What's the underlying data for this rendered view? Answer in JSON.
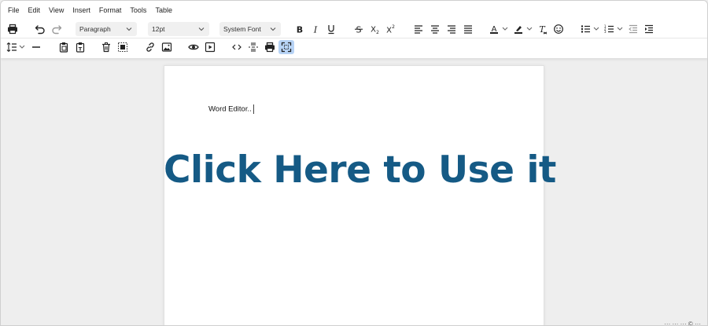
{
  "menu": {
    "items": [
      "File",
      "Edit",
      "View",
      "Insert",
      "Format",
      "Tools",
      "Table"
    ]
  },
  "toolbar": {
    "block_format": "Paragraph",
    "font_size": "12pt",
    "font_family": "System Font"
  },
  "document": {
    "text": "Word Editor.."
  },
  "overlay": {
    "cta": "Click Here to Use it"
  },
  "status": {
    "fragment": "··· ··· ··· © ···"
  },
  "colors": {
    "accent": "#155a85",
    "active_button": "#b7d3f5",
    "page": "#ffffff",
    "workspace": "#eeeeee"
  }
}
